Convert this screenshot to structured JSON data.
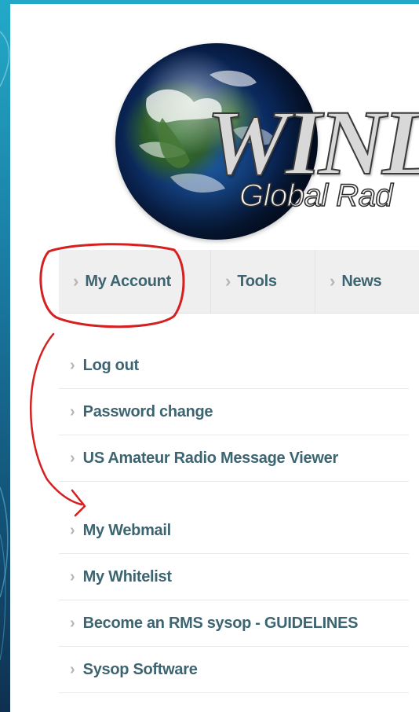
{
  "logo": {
    "title": "WINL",
    "subtitle": "Global Rad"
  },
  "nav": {
    "items": [
      {
        "label": "My Account"
      },
      {
        "label": "Tools"
      },
      {
        "label": "News"
      }
    ]
  },
  "menu": {
    "group1": [
      {
        "label": "Log out"
      },
      {
        "label": "Password change"
      },
      {
        "label": "US Amateur Radio Message Viewer"
      }
    ],
    "group2": [
      {
        "label": "My Webmail"
      },
      {
        "label": "My Whitelist"
      },
      {
        "label": "Become an RMS sysop - GUIDELINES"
      },
      {
        "label": "Sysop Software"
      }
    ]
  },
  "icons": {
    "menu_chevron": "chevron-right-icon"
  },
  "colors": {
    "link_text": "#3d6571",
    "nav_bg": "#efefef",
    "annotation_red": "#d42020",
    "slide_background": "#1a7fa6"
  }
}
